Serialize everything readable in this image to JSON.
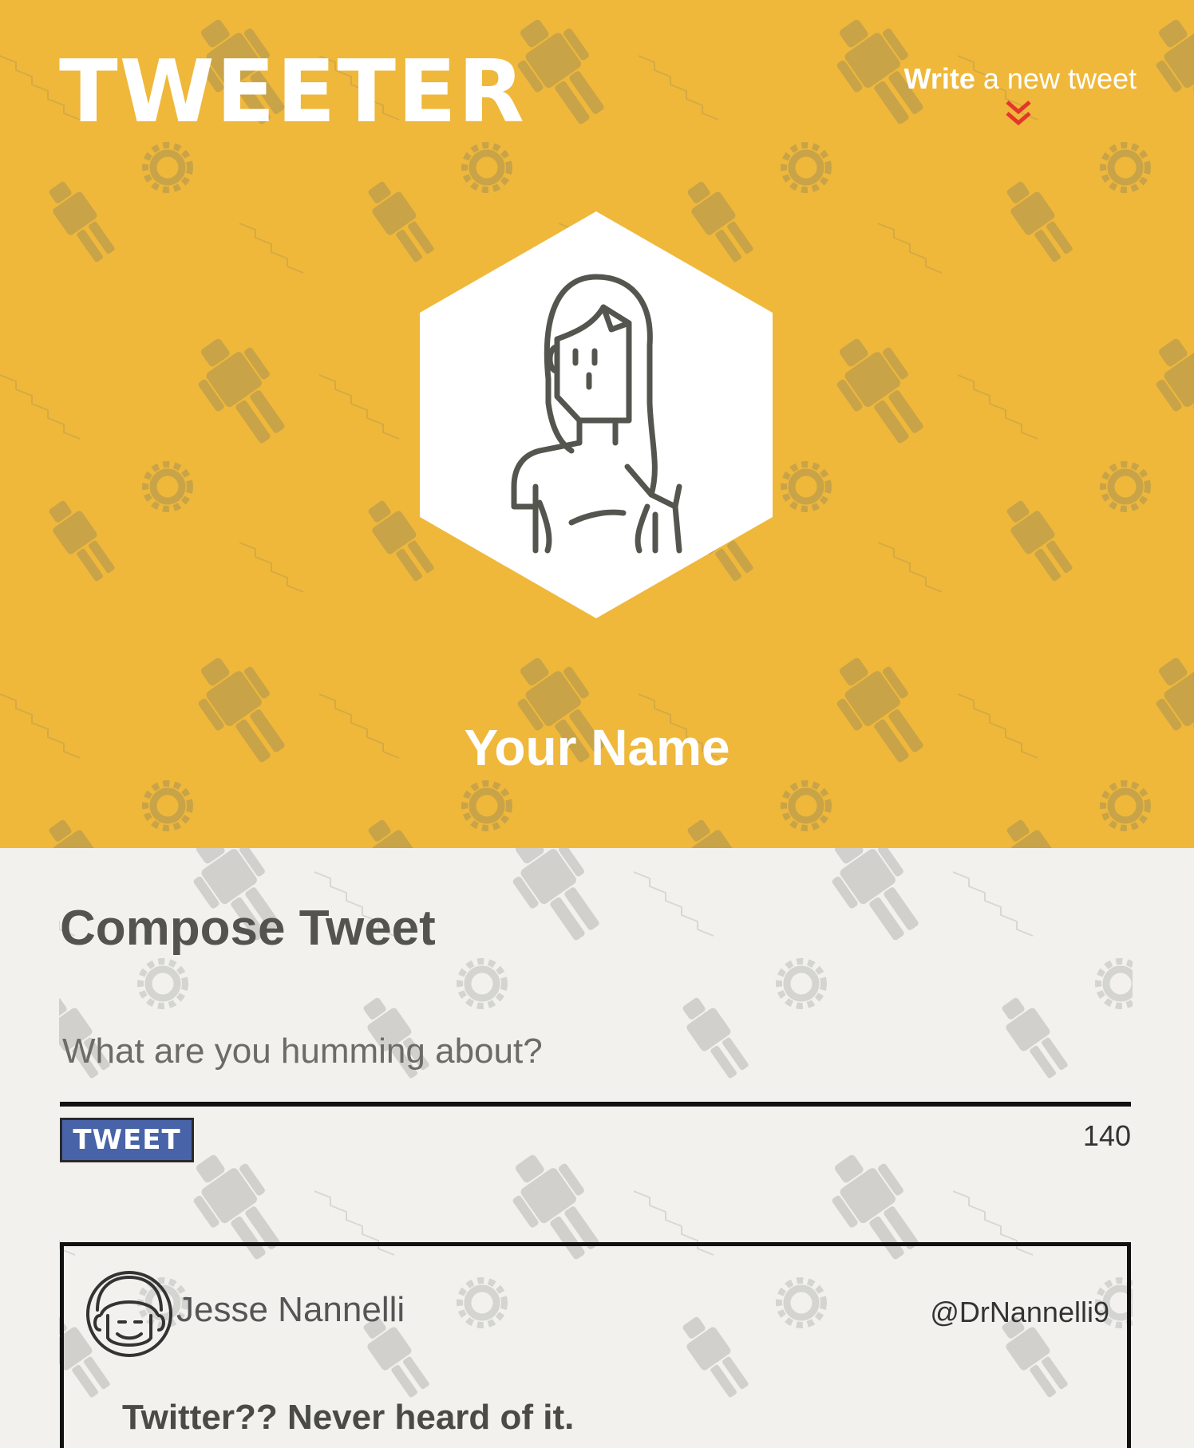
{
  "header": {
    "logo": "TWEETER",
    "write_link": {
      "bold": "Write",
      "rest": " a new tweet"
    },
    "profile_name": "Your Name"
  },
  "compose": {
    "title": "Compose Tweet",
    "placeholder": "What are you humming about?",
    "button_label": "TWEET",
    "char_counter": "140"
  },
  "tweets": [
    {
      "name": "Jesse Nannelli",
      "handle": "@DrNannelli9",
      "text": "Twitter?? Never heard of it."
    }
  ],
  "colors": {
    "header_bg": "#efb83b",
    "body_bg": "#f2f1ed",
    "button_bg": "#4863a8",
    "chevron": "#e3362c"
  },
  "icons": [
    "double-chevron-down-icon",
    "user-avatar-icon",
    "tweet-author-avatar-icon"
  ]
}
